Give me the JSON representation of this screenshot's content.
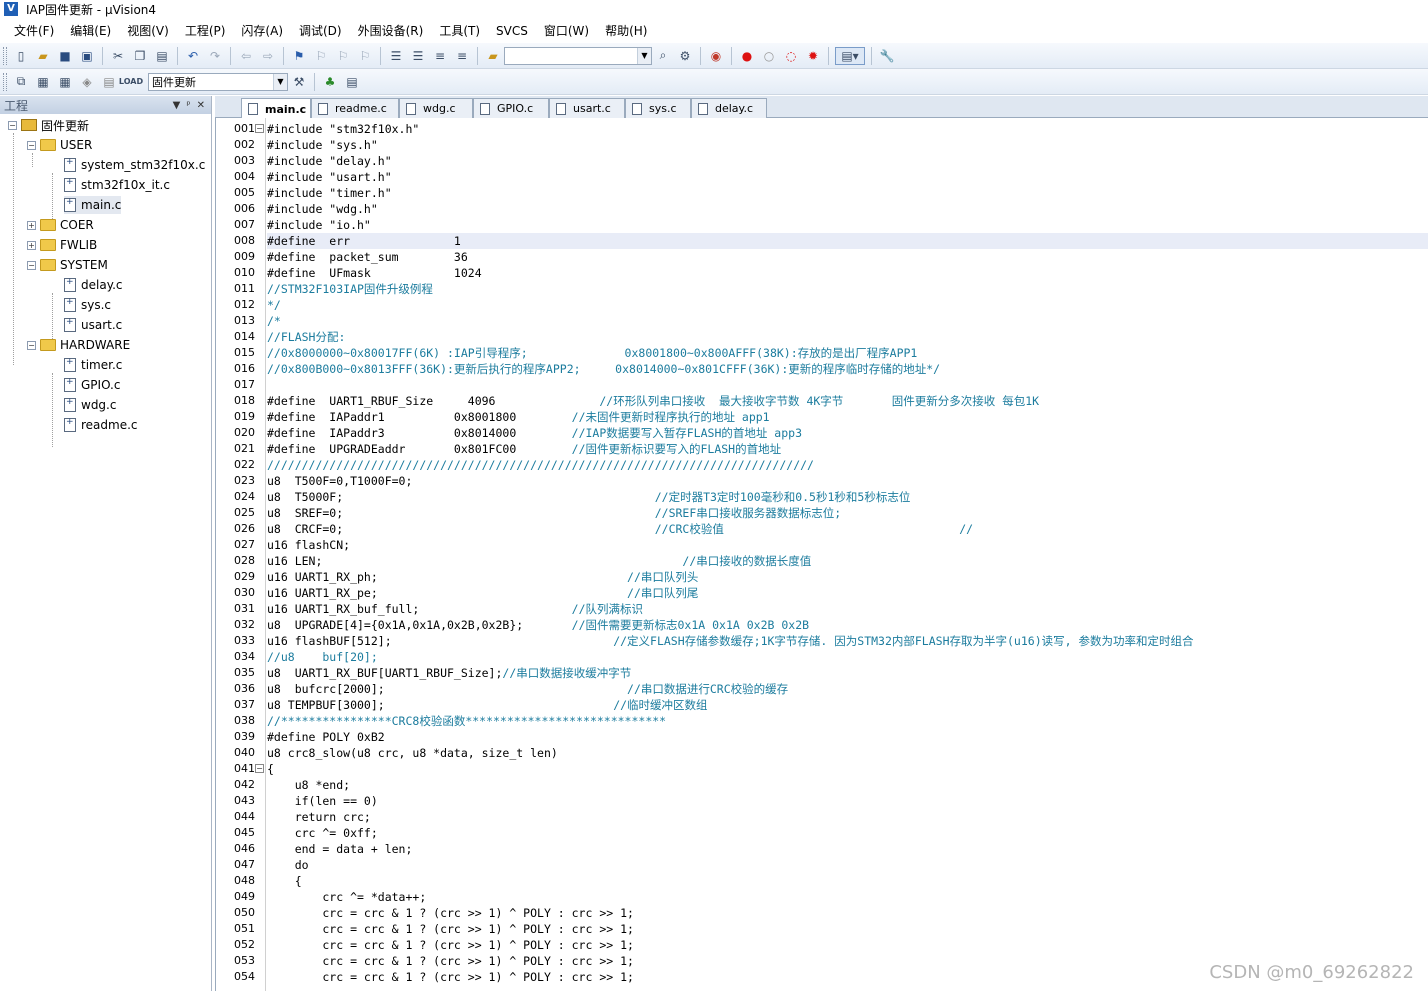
{
  "window": {
    "title": "IAP固件更新 - µVision4",
    "app_icon": "V"
  },
  "menu": [
    "文件(F)",
    "编辑(E)",
    "视图(V)",
    "工程(P)",
    "闪存(A)",
    "调试(D)",
    "外围设备(R)",
    "工具(T)",
    "SVCS",
    "窗口(W)",
    "帮助(H)"
  ],
  "toolbar2": {
    "target_select": "固件更新"
  },
  "project": {
    "header": "工程",
    "root": "固件更新",
    "groups": [
      {
        "name": "USER",
        "files": [
          "system_stm32f10x.c",
          "stm32f10x_it.c",
          "main.c"
        ]
      },
      {
        "name": "COER",
        "files": []
      },
      {
        "name": "FWLIB",
        "files": []
      },
      {
        "name": "SYSTEM",
        "files": [
          "delay.c",
          "sys.c",
          "usart.c"
        ]
      },
      {
        "name": "HARDWARE",
        "files": [
          "timer.c",
          "GPIO.c",
          "wdg.c",
          "readme.c"
        ]
      }
    ]
  },
  "tabs": [
    "main.c",
    "readme.c",
    "wdg.c",
    "GPIO.c",
    "usart.c",
    "sys.c",
    "delay.c"
  ],
  "active_tab": "main.c",
  "line_numbers": [
    "001",
    "002",
    "003",
    "004",
    "005",
    "006",
    "007",
    "008",
    "009",
    "010",
    "011",
    "012",
    "013",
    "014",
    "015",
    "016",
    "017",
    "018",
    "019",
    "020",
    "021",
    "022",
    "023",
    "024",
    "025",
    "026",
    "027",
    "028",
    "029",
    "030",
    "031",
    "032",
    "033",
    "034",
    "035",
    "036",
    "037",
    "038",
    "039",
    "040",
    "041",
    "042",
    "043",
    "044",
    "045",
    "046",
    "047",
    "048",
    "049",
    "050",
    "051",
    "052",
    "053",
    "054"
  ],
  "code_lines": [
    "#include \"stm32f10x.h\"",
    "#include \"sys.h\"",
    "#include \"delay.h\"",
    "#include \"usart.h\"",
    "#include \"timer.h\"",
    "#include \"wdg.h\"",
    "#include \"io.h\"",
    "#define  err               1",
    "#define  packet_sum        36",
    "#define  UFmask            1024",
    "//STM32F103IAP固件升级例程",
    "*/",
    "/*",
    "//FLASH分配:",
    "//0x8000000~0x80017FF(6K) :IAP引导程序;              0x8001800~0x800AFFF(38K):存放的是出厂程序APP1",
    "//0x800B000~0x8013FFF(36K):更新后执行的程序APP2;     0x8014000~0x801CFFF(36K):更新的程序临时存储的地址*/",
    "",
    "#define  UART1_RBUF_Size     4096               //环形队列串口接收  最大接收字节数 4K字节       固件更新分多次接收 每包1K",
    "#define  IAPaddr1          0x8001800        //未固件更新时程序执行的地址 app1",
    "#define  IAPaddr3          0x8014000        //IAP数据要写入暂存FLASH的首地址 app3",
    "#define  UPGRADEaddr       0x801FC00        //固件更新标识要写入的FLASH的首地址",
    "///////////////////////////////////////////////////////////////////////////////",
    "u8  T500F=0,T1000F=0;",
    "u8  T5000F;                                             //定时器T3定时100毫秒和0.5秒1秒和5秒标志位",
    "u8  SREF=0;                                             //SREF串口接收服务器数据标志位;",
    "u8  CRCF=0;                                             //CRC校验值                                  //",
    "u16 flashCN;",
    "u16 LEN;                                                    //串口接收的数据长度值",
    "u16 UART1_RX_ph;                                    //串口队列头",
    "u16 UART1_RX_pe;                                    //串口队列尾",
    "u16 UART1_RX_buf_full;                      //队列满标识",
    "u8  UPGRADE[4]={0x1A,0x1A,0x2B,0x2B};       //固件需要更新标志0x1A 0x1A 0x2B 0x2B",
    "u16 flashBUF[512];                                //定义FLASH存储参数缓存;1K字节存储. 因为STM32内部FLASH存取为半字(u16)读写, 参数为功率和定时组合",
    "//u8    buf[20];",
    "u8  UART1_RX_BUF[UART1_RBUF_Size];//串口数据接收缓冲字节",
    "u8  bufcrc[2000];                                   //串口数据进行CRC校验的缓存",
    "u8 TEMPBUF[3000];                                 //临时缓冲区数组",
    "//****************CRC8校验函数*****************************",
    "#define POLY 0xB2",
    "u8 crc8_slow(u8 crc, u8 *data, size_t len)",
    "{",
    "    u8 *end;",
    "    if(len == 0)",
    "    return crc;",
    "    crc ^= 0xff;",
    "    end = data + len;",
    "    do",
    "    {",
    "        crc ^= *data++;",
    "        crc = crc & 1 ? (crc >> 1) ^ POLY : crc >> 1;",
    "        crc = crc & 1 ? (crc >> 1) ^ POLY : crc >> 1;",
    "        crc = crc & 1 ? (crc >> 1) ^ POLY : crc >> 1;",
    "        crc = crc & 1 ? (crc >> 1) ^ POLY : crc >> 1;",
    "        crc = crc & 1 ? (crc >> 1) ^ POLY : crc >> 1;"
  ],
  "highlighted_line": 8,
  "watermark": "CSDN @m0_69262822",
  "colors": {
    "comment": "#1c7c9e",
    "number": "#c0392b",
    "highlight": "#e8ecf7"
  }
}
